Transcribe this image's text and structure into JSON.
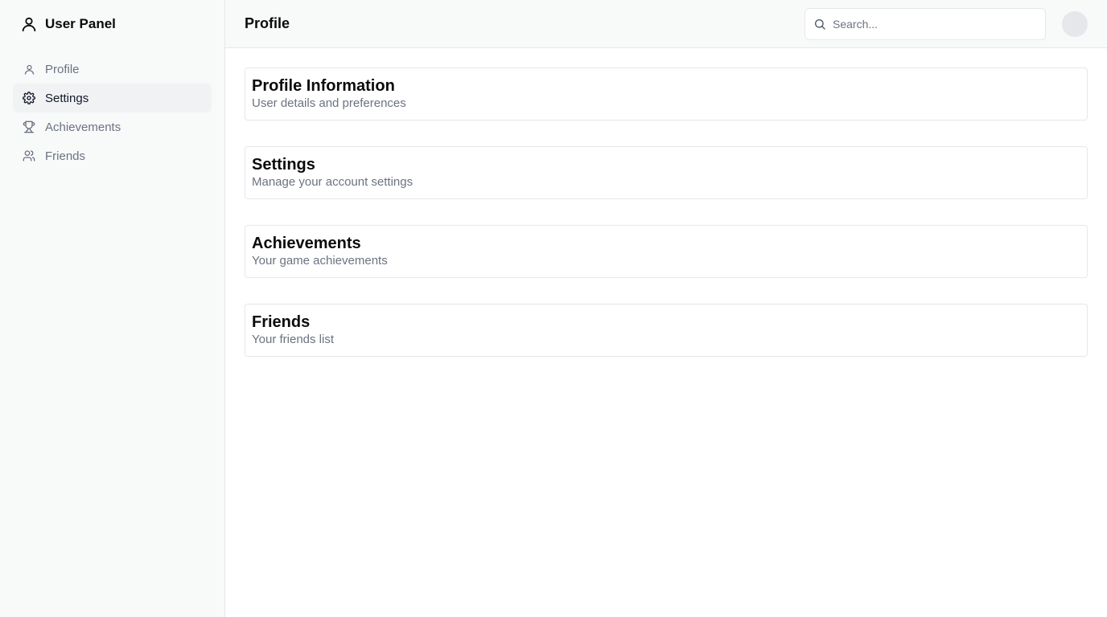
{
  "sidebar": {
    "title": "User Panel",
    "brand_icon": "user-icon",
    "items": [
      {
        "label": "Profile",
        "icon": "user-icon",
        "active": false
      },
      {
        "label": "Settings",
        "icon": "gear-icon",
        "active": true
      },
      {
        "label": "Achievements",
        "icon": "trophy-icon",
        "active": false
      },
      {
        "label": "Friends",
        "icon": "users-icon",
        "active": false
      }
    ]
  },
  "header": {
    "title": "Profile",
    "search_placeholder": "Search...",
    "search_value": ""
  },
  "cards": [
    {
      "title": "Profile Information",
      "description": "User details and preferences"
    },
    {
      "title": "Settings",
      "description": "Manage your account settings"
    },
    {
      "title": "Achievements",
      "description": "Your game achievements"
    },
    {
      "title": "Friends",
      "description": "Your friends list"
    }
  ],
  "colors": {
    "sidebar_bg": "#f8fafa",
    "active_item_bg": "#f1f2f4",
    "muted_text": "#6b7280",
    "border": "#e5e7eb"
  }
}
